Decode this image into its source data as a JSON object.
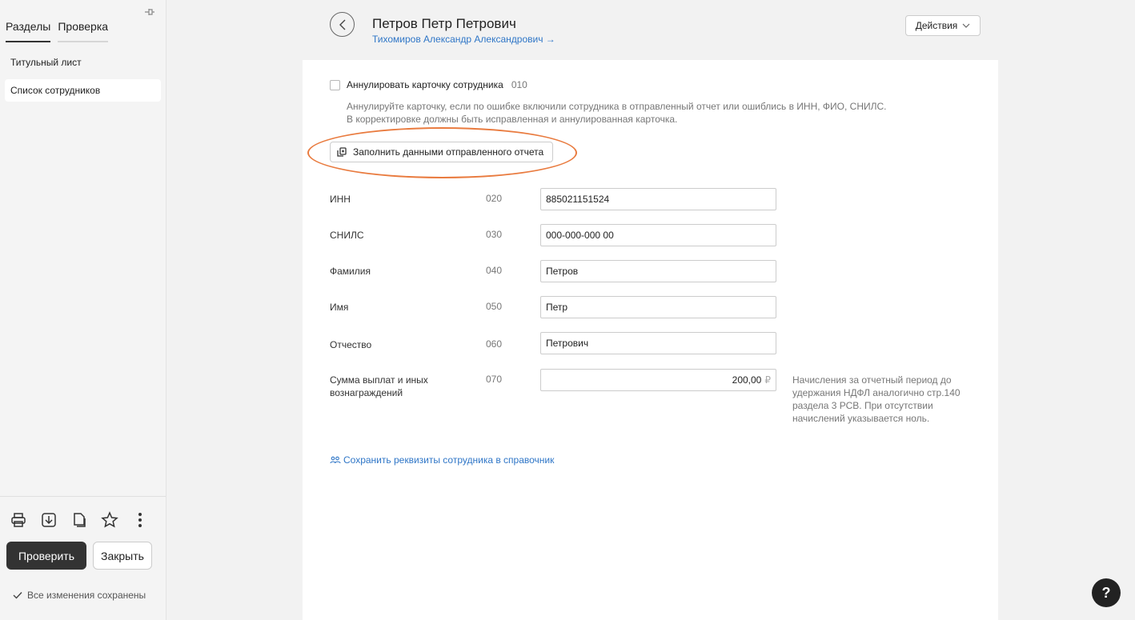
{
  "sidebar": {
    "tabs": [
      "Разделы",
      "Проверка"
    ],
    "items": [
      "Титульный лист",
      "Список сотрудников"
    ],
    "tool_icons": [
      "printer-icon",
      "download-icon",
      "copy-icon",
      "star-icon",
      "more-icon"
    ],
    "check_label": "Проверить",
    "close_label": "Закрыть",
    "saved_text": "Все изменения сохранены"
  },
  "header": {
    "title": "Петров Петр Петрович",
    "subtitle": "Тихомиров Александр Александрович →",
    "actions_label": "Действия"
  },
  "form": {
    "annul_label": "Аннулировать карточку сотрудника",
    "annul_code": "010",
    "annul_hint_1": "Аннулируйте карточку, если по ошибке включили сотрудника в отправленный отчет или ошиблись в ИНН, ФИО, СНИЛС.",
    "annul_hint_2": "В корректировке должны быть исправленная и аннулированная карточка.",
    "fill_button": "Заполнить данными отправленного отчета",
    "rows": [
      {
        "label": "ИНН",
        "code": "020",
        "value": "885021151524"
      },
      {
        "label": "СНИЛС",
        "code": "030",
        "value": "000-000-000 00"
      },
      {
        "label": "Фамилия",
        "code": "040",
        "value": "Петров"
      },
      {
        "label": "Имя",
        "code": "050",
        "value": "Петр"
      },
      {
        "label": "Отчество",
        "code": "060",
        "value": "Петрович"
      },
      {
        "label": "Сумма выплат и иных вознаграждений",
        "code": "070",
        "value": "200,00",
        "currency": "₽"
      }
    ],
    "hint_070": "Начисления за отчетный период до удержания НДФЛ аналогично стр.140 раздела 3 РСВ. При отсутствии начислений указывается ноль.",
    "save_link": "Сохранить реквизиты сотрудника в справочник"
  },
  "help_label": "?",
  "colors": {
    "accent": "#2f76c7",
    "highlight": "#e97b3f",
    "dark_button": "#333333"
  }
}
